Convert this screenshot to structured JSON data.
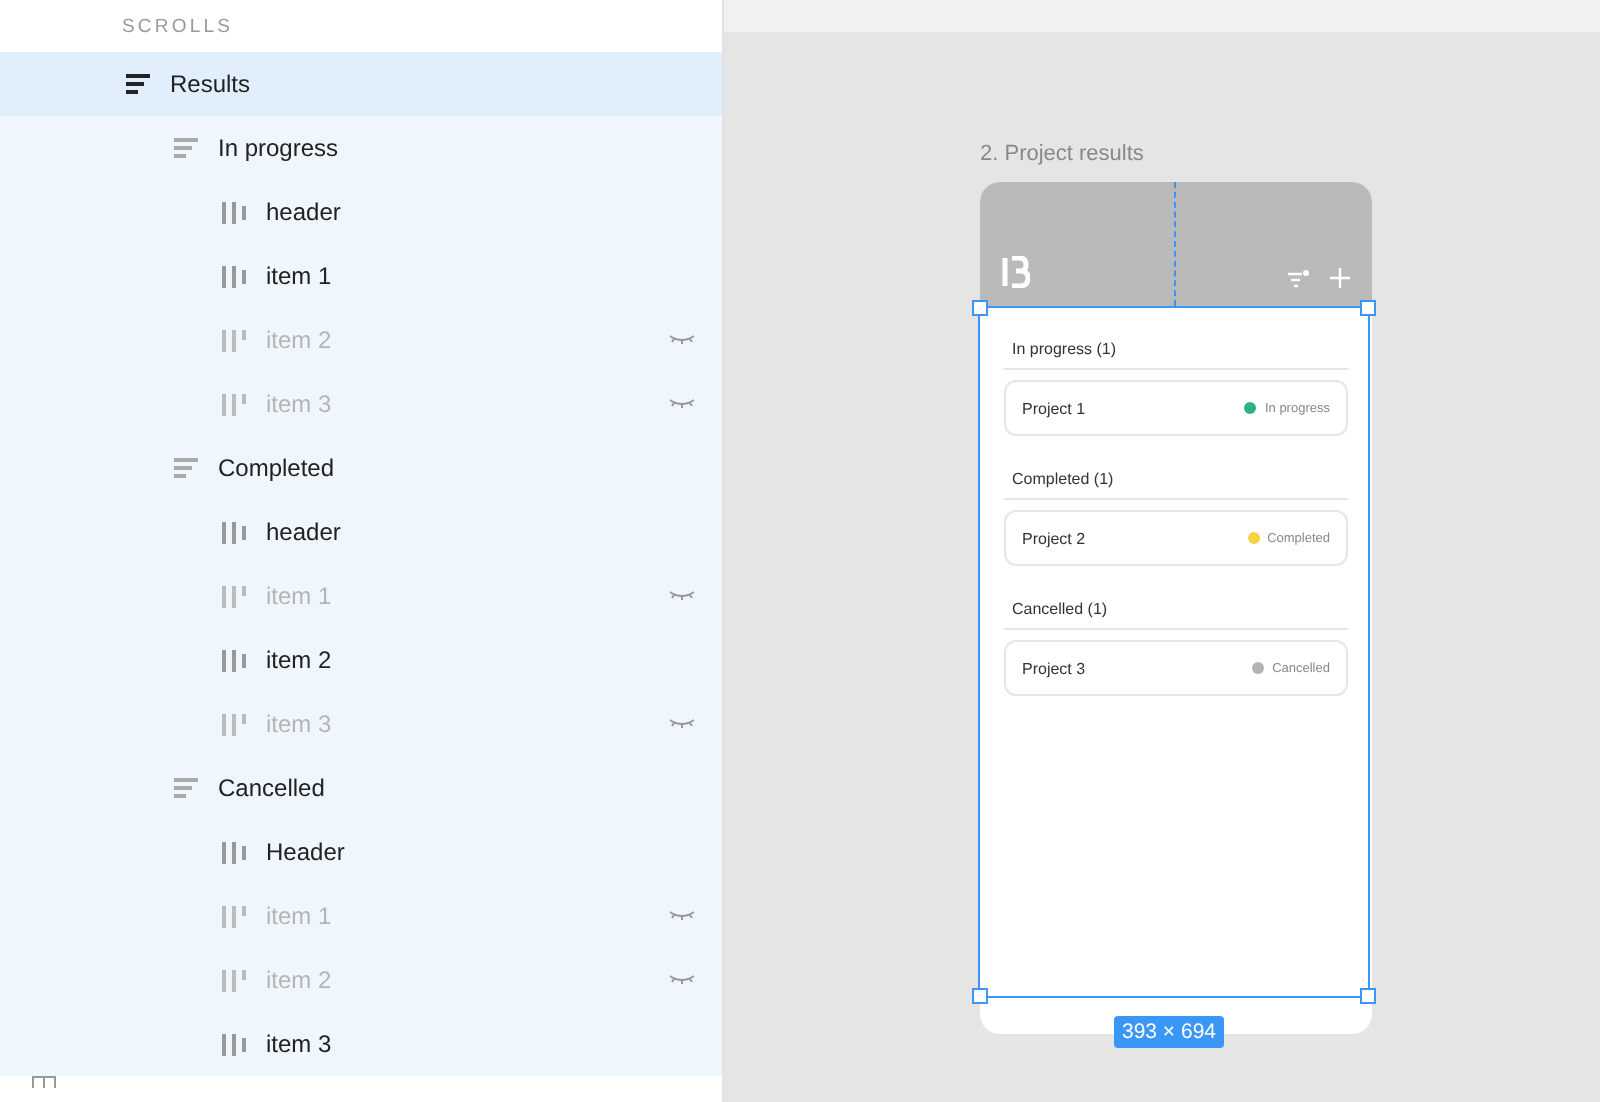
{
  "layers": {
    "section_title": "SCROLLS",
    "tree": [
      {
        "label": "Results",
        "kind": "group",
        "selected": true,
        "hidden": false,
        "children": [
          {
            "label": "In progress",
            "kind": "group",
            "selected": false,
            "hidden": false,
            "children": [
              {
                "label": "header",
                "kind": "item",
                "selected": false,
                "hidden": false
              },
              {
                "label": "item 1",
                "kind": "item",
                "selected": false,
                "hidden": false
              },
              {
                "label": "item 2",
                "kind": "item",
                "selected": false,
                "hidden": true
              },
              {
                "label": "item 3",
                "kind": "item",
                "selected": false,
                "hidden": true
              }
            ]
          },
          {
            "label": "Completed",
            "kind": "group",
            "selected": false,
            "hidden": false,
            "children": [
              {
                "label": "header",
                "kind": "item",
                "selected": false,
                "hidden": false
              },
              {
                "label": "item 1",
                "kind": "item",
                "selected": false,
                "hidden": true
              },
              {
                "label": "item 2",
                "kind": "item",
                "selected": false,
                "hidden": false
              },
              {
                "label": "item 3",
                "kind": "item",
                "selected": false,
                "hidden": true
              }
            ]
          },
          {
            "label": "Cancelled",
            "kind": "group",
            "selected": false,
            "hidden": false,
            "children": [
              {
                "label": "Header",
                "kind": "item",
                "selected": false,
                "hidden": false
              },
              {
                "label": "item 1",
                "kind": "item",
                "selected": false,
                "hidden": true
              },
              {
                "label": "item 2",
                "kind": "item",
                "selected": false,
                "hidden": true
              },
              {
                "label": "item 3",
                "kind": "item",
                "selected": false,
                "hidden": false
              }
            ]
          }
        ]
      }
    ]
  },
  "canvas": {
    "frame_title": "2. Project results",
    "size_badge": "393 × 694",
    "sections": [
      {
        "title": "In progress (1)",
        "project": "Project 1",
        "status": "In progress",
        "color": "#2fb27f"
      },
      {
        "title": "Completed (1)",
        "project": "Project 2",
        "status": "Completed",
        "color": "#f5d547"
      },
      {
        "title": "Cancelled (1)",
        "project": "Project 3",
        "status": "Cancelled",
        "color": "#b3b3b3"
      }
    ]
  }
}
